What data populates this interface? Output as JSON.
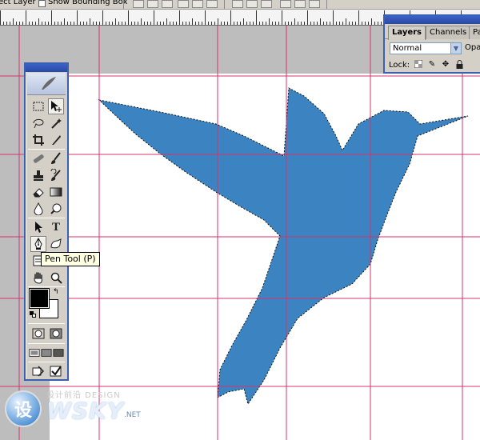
{
  "options_bar": {
    "auto_select_label": "ect Layer",
    "show_bounding_box_label": "Show Bounding Box"
  },
  "canvas": {
    "document_color": "#ffffff",
    "guide_color": "#d6336c",
    "shape_color": "#3b84c1",
    "shape_name": "hummingbird-silhouette"
  },
  "toolbox": {
    "tools": [
      {
        "name": "rectangular-marquee-icon"
      },
      {
        "name": "move-icon"
      },
      {
        "name": "lasso-icon"
      },
      {
        "name": "magic-wand-icon"
      },
      {
        "name": "crop-icon"
      },
      {
        "name": "slice-icon"
      },
      {
        "name": "healing-brush-icon"
      },
      {
        "name": "brush-icon"
      },
      {
        "name": "clone-stamp-icon"
      },
      {
        "name": "history-brush-icon"
      },
      {
        "name": "eraser-icon"
      },
      {
        "name": "gradient-icon"
      },
      {
        "name": "blur-icon"
      },
      {
        "name": "dodge-icon"
      },
      {
        "name": "path-selection-icon"
      },
      {
        "name": "type-icon",
        "glyph": "T"
      },
      {
        "name": "pen-icon"
      },
      {
        "name": "custom-shape-icon"
      },
      {
        "name": "notes-icon"
      },
      {
        "name": "eyedropper-icon"
      },
      {
        "name": "hand-icon"
      },
      {
        "name": "zoom-icon"
      }
    ],
    "foreground_color": "#000000",
    "background_color": "#ffffff"
  },
  "tooltip": {
    "text": "Pen Tool (P)"
  },
  "layers_panel": {
    "tabs": [
      "Layers",
      "Channels",
      "Pa"
    ],
    "active_tab": "Layers",
    "blend_mode": "Normal",
    "opacity_label": "Opac",
    "lock_label": "Lock:"
  },
  "watermark": {
    "glyph": "设",
    "tagline": "设计前沿 DESIGN",
    "brand": "WSKY",
    "domain": ".NET"
  }
}
